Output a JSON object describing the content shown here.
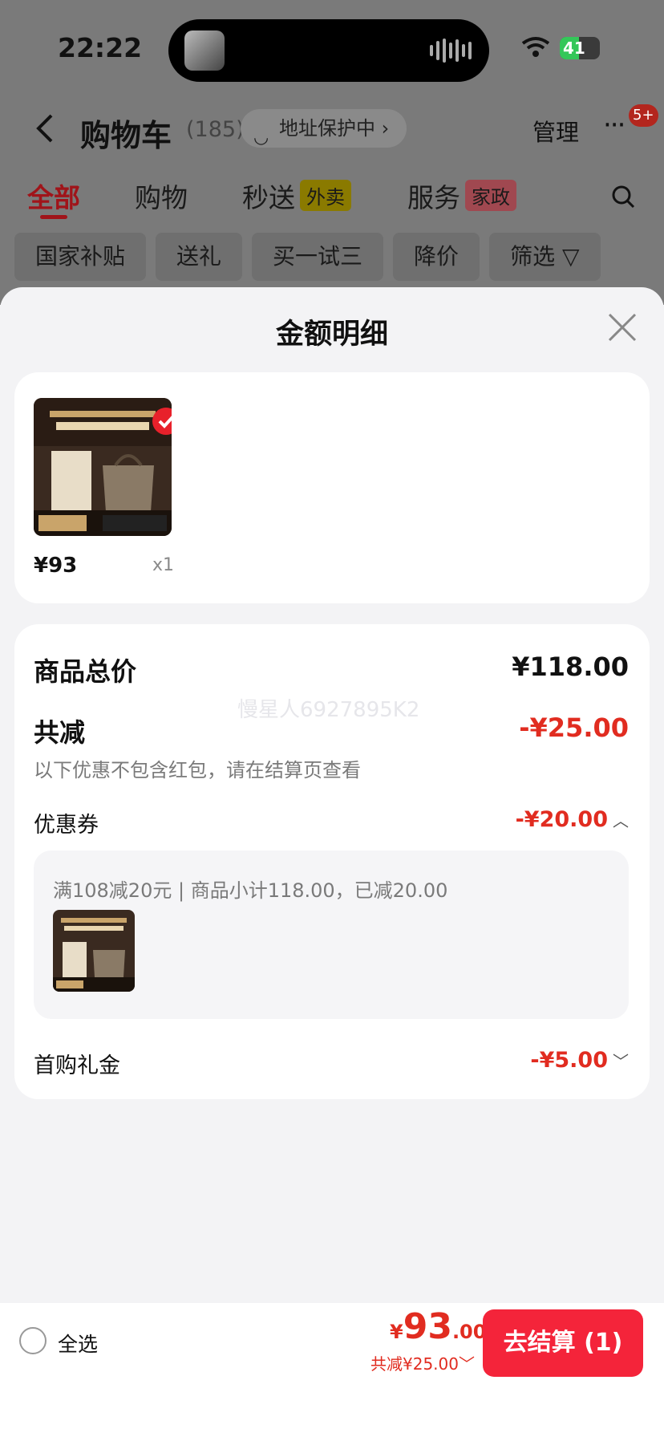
{
  "status_bar": {
    "time": "22:22",
    "battery": "41"
  },
  "nav": {
    "title": "购物车",
    "count": "(185)",
    "address_status": "地址保护中 ›",
    "manage": "管理",
    "more": "···",
    "badge": "5+"
  },
  "tabs": [
    {
      "label": "全部",
      "active": true
    },
    {
      "label": "购物"
    },
    {
      "label": "秒送",
      "tag": "外卖"
    },
    {
      "label": "服务",
      "tag": "家政"
    }
  ],
  "chips": [
    "国家补贴",
    "送礼",
    "买一试三",
    "降价",
    "筛选 ▽"
  ],
  "sheet": {
    "title": "金额明细",
    "product": {
      "price": "¥93",
      "qty": "x1"
    },
    "total_label": "商品总价",
    "total_value": "¥118.00",
    "watermark": "慢星人6927895K2",
    "discount_label": "共减",
    "discount_value": "-¥25.00",
    "discount_note": "以下优惠不包含红包，请在结算页查看",
    "coupon_label": "优惠券",
    "coupon_value": "-¥20.00",
    "coupon_detail": "满108减20元 | 商品小计118.00，已减20.00",
    "gift_label": "首购礼金",
    "gift_value": "-¥5.00"
  },
  "bottom_bar": {
    "select_all": "全选",
    "price_symbol": "¥",
    "price_int": "93",
    "price_dec": ".00",
    "discount_sub": "共减¥25.00",
    "checkout": "去结算 (1)"
  },
  "colors": {
    "accent_red": "#e12c20",
    "checkout_red": "#f4243a"
  }
}
